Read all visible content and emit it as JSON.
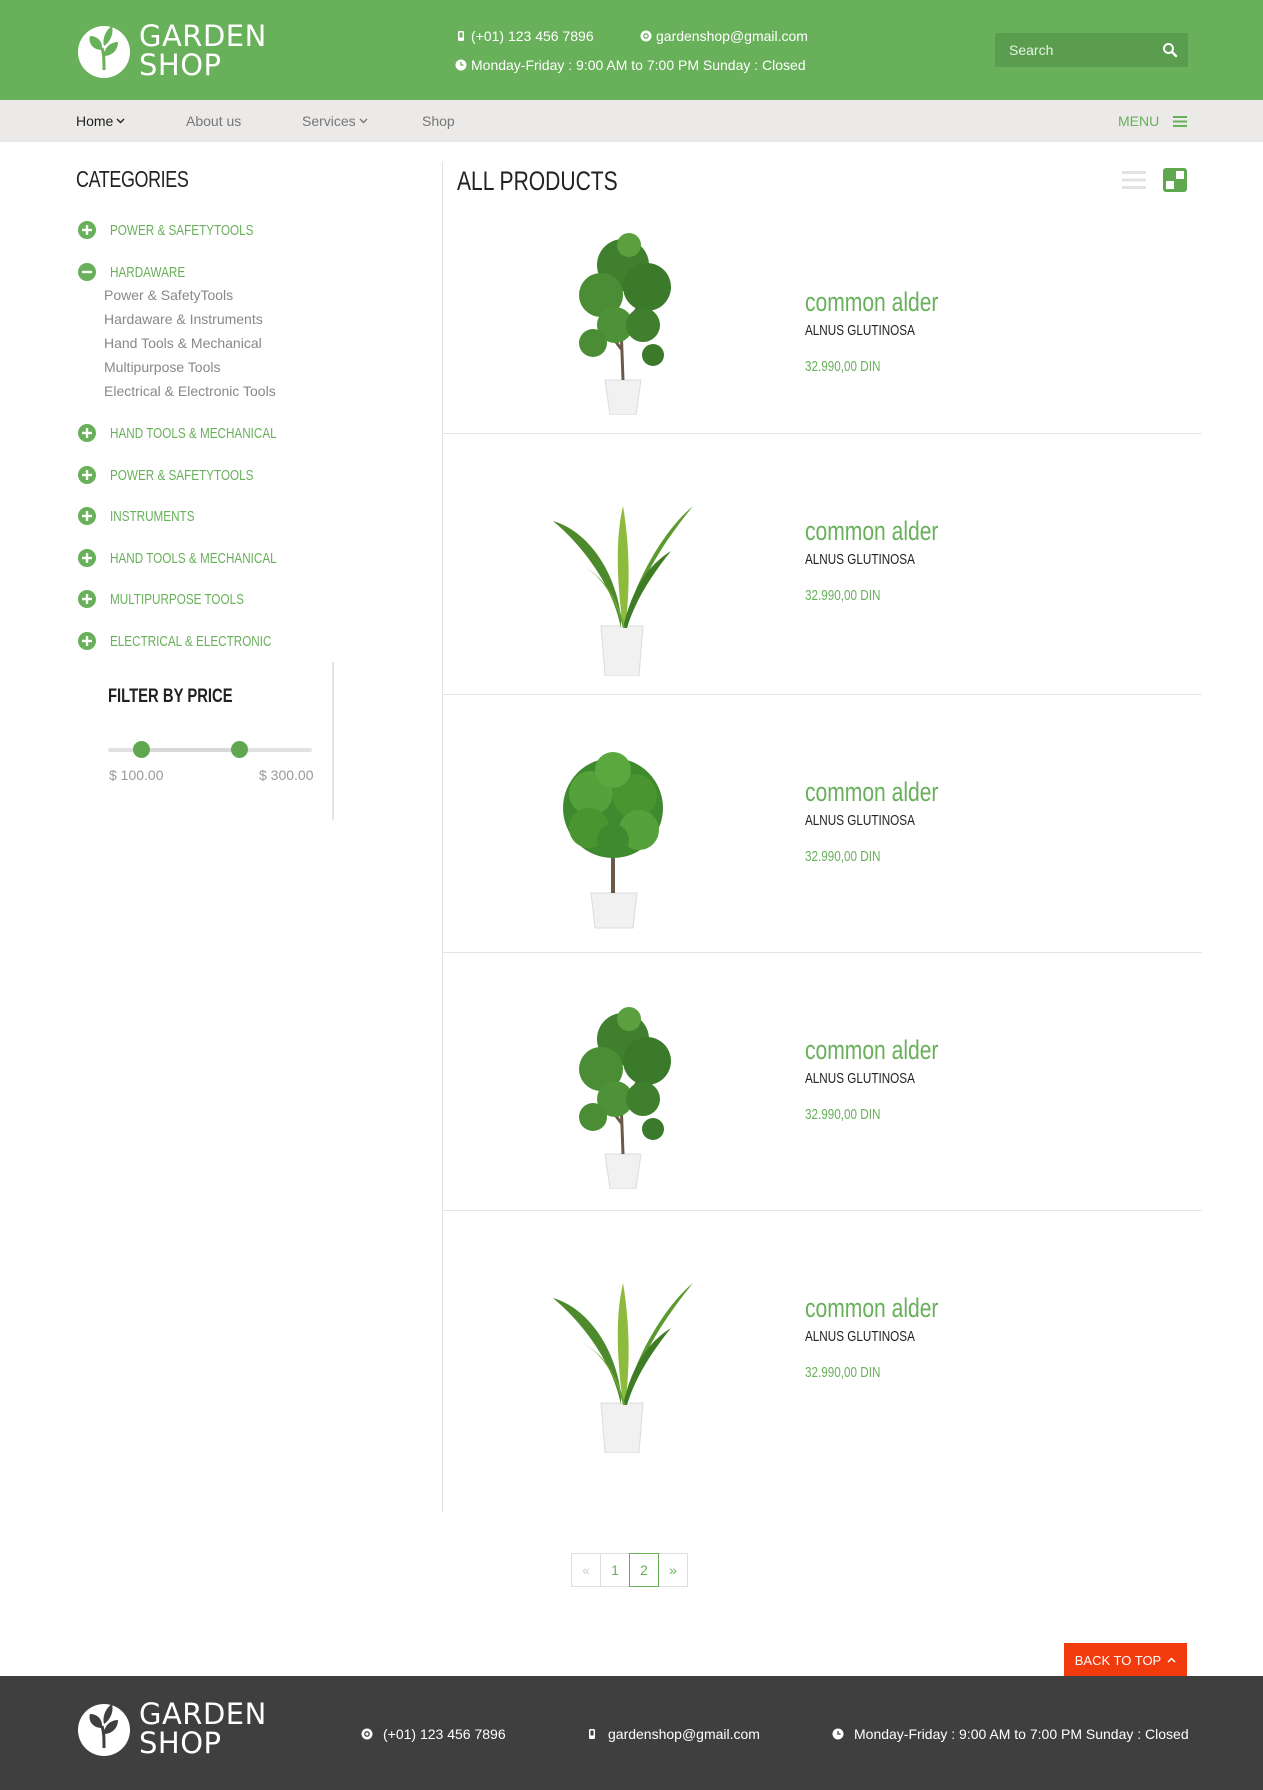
{
  "brand": {
    "line1": "GARDEN",
    "line2": "SHOP"
  },
  "header": {
    "phone": "(+01) 123 456 7896",
    "email": "gardenshop@gmail.com",
    "hours": "Monday-Friday : 9:00 AM to 7:00 PM Sunday : Closed",
    "search_placeholder": "Search"
  },
  "nav": {
    "items": [
      {
        "label": "Home",
        "active": true,
        "dropdown": true
      },
      {
        "label": "About us",
        "active": false,
        "dropdown": false
      },
      {
        "label": "Services",
        "active": false,
        "dropdown": true
      },
      {
        "label": "Shop",
        "active": false,
        "dropdown": false
      }
    ],
    "menu_label": "MENU"
  },
  "sidebar": {
    "title": "CATEGORIES",
    "categories": [
      {
        "label": "POWER & SAFETYTOOLS",
        "expanded": false
      },
      {
        "label": "HARDAWARE",
        "expanded": true,
        "children": [
          "Power & SafetyTools",
          "Hardaware & Instruments",
          "Hand Tools & Mechanical",
          "Multipurpose Tools",
          "Electrical & Electronic Tools"
        ]
      },
      {
        "label": "HAND TOOLS & MECHANICAL",
        "expanded": false
      },
      {
        "label": "POWER & SAFETYTOOLS",
        "expanded": false
      },
      {
        "label": "INSTRUMENTS",
        "expanded": false
      },
      {
        "label": "HAND TOOLS & MECHANICAL",
        "expanded": false
      },
      {
        "label": "MULTIPURPOSE TOOLS",
        "expanded": false
      },
      {
        "label": "ELECTRICAL & ELECTRONIC",
        "expanded": false
      }
    ],
    "filter": {
      "title": "FILTER BY PRICE",
      "min_label": "$ 100.00",
      "max_label": "$ 300.00",
      "min_fraction": 0.16,
      "max_fraction": 0.64
    }
  },
  "main": {
    "title": "ALL PRODUCTS",
    "products": [
      {
        "name": "common alder",
        "latin": "ALNUS GLUTINOSA",
        "price": "32.990,00 DIN",
        "plant": "pine-tree"
      },
      {
        "name": "common alder",
        "latin": "ALNUS GLUTINOSA",
        "price": "32.990,00 DIN",
        "plant": "dracaena"
      },
      {
        "name": "common alder",
        "latin": "ALNUS GLUTINOSA",
        "price": "32.990,00 DIN",
        "plant": "bushy-tree"
      },
      {
        "name": "common alder",
        "latin": "ALNUS GLUTINOSA",
        "price": "32.990,00 DIN",
        "plant": "pine-tree"
      },
      {
        "name": "common alder",
        "latin": "ALNUS GLUTINOSA",
        "price": "32.990,00 DIN",
        "plant": "dracaena"
      }
    ]
  },
  "pagination": {
    "prev": "«",
    "pages": [
      "1",
      "2"
    ],
    "current": "2",
    "next": "»"
  },
  "back_to_top": "BACK TO TOP",
  "footer": {
    "phone": "(+01) 123 456 7896",
    "email": "gardenshop@gmail.com",
    "hours": "Monday-Friday : 9:00 AM to 7:00 PM Sunday : Closed"
  },
  "colors": {
    "brand_green": "#68b05a",
    "nav_bg": "#eceae8",
    "footer_bg": "#3f3f3f",
    "back_top_red": "#f23b0c"
  }
}
